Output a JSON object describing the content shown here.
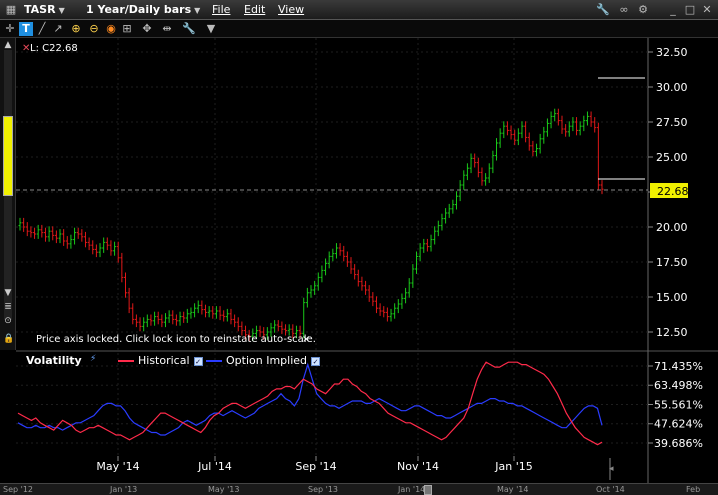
{
  "window": {
    "symbol": "TASR",
    "period": "1 Year/Daily bars",
    "menu": [
      "File",
      "Edit",
      "View"
    ]
  },
  "chart": {
    "last_label": "L: C22.68",
    "last_price": "22.68",
    "lock_message": "Price axis locked. Click lock icon to reinstate auto-scale.",
    "lock_close": "×",
    "price_ticks": [
      "32.50",
      "30.00",
      "27.50",
      "25.00",
      "22.50",
      "20.00",
      "17.50",
      "15.00",
      "12.50"
    ],
    "vol_ticks": [
      "71.435%",
      "63.498%",
      "55.561%",
      "47.624%",
      "39.686%"
    ],
    "x_ticks": [
      "May '14",
      "Jul '14",
      "Sep '14",
      "Nov '14",
      "Jan '15"
    ],
    "colors": {
      "up": "#19c819",
      "down": "#e01818",
      "historical": "#ff2a4a",
      "implied": "#2a3cff",
      "last_badge": "#f0f000"
    }
  },
  "legend": {
    "title": "Volatility",
    "historical": "Historical",
    "implied": "Option Implied"
  },
  "timeline": {
    "labels": [
      "Sep '12",
      "Jan '13",
      "May '13",
      "Sep '13",
      "Jan '14",
      "May '14",
      "Oct '14",
      "Feb"
    ]
  },
  "chart_data": {
    "type": "candlestick",
    "ohlc_close": [
      20.3,
      20.0,
      19.7,
      19.6,
      19.5,
      19.8,
      19.6,
      19.3,
      19.7,
      19.4,
      19.2,
      19.5,
      19.0,
      18.8,
      19.1,
      19.6,
      19.5,
      19.3,
      18.9,
      18.7,
      18.4,
      18.2,
      18.5,
      18.9,
      18.7,
      18.3,
      18.6,
      17.8,
      16.4,
      15.3,
      14.2,
      13.4,
      13.2,
      12.9,
      13.2,
      13.4,
      13.3,
      13.6,
      13.4,
      13.2,
      13.5,
      13.7,
      13.4,
      13.3,
      13.6,
      13.5,
      13.8,
      13.9,
      14.2,
      14.4,
      14.1,
      13.9,
      14.0,
      13.8,
      14.0,
      13.7,
      13.6,
      13.8,
      13.4,
      13.2,
      12.9,
      12.6,
      12.3,
      12.2,
      12.4,
      12.6,
      12.5,
      12.3,
      12.5,
      12.8,
      13.0,
      12.9,
      12.7,
      12.6,
      12.7,
      12.4,
      12.6,
      12.4,
      14.6,
      15.3,
      15.5,
      15.8,
      16.4,
      16.9,
      17.4,
      17.9,
      18.1,
      18.5,
      18.3,
      17.9,
      17.5,
      17.0,
      16.6,
      16.1,
      15.8,
      15.5,
      15.0,
      14.7,
      14.2,
      14.0,
      13.9,
      13.6,
      13.8,
      14.2,
      14.5,
      14.9,
      15.3,
      16.0,
      17.0,
      17.9,
      18.5,
      18.8,
      18.6,
      19.1,
      19.7,
      20.1,
      20.6,
      21.0,
      21.3,
      21.6,
      22.2,
      23.0,
      23.7,
      24.2,
      24.9,
      24.6,
      23.9,
      23.3,
      23.5,
      24.2,
      25.1,
      26.0,
      26.7,
      27.2,
      26.9,
      26.6,
      26.2,
      26.7,
      27.2,
      26.4,
      25.8,
      25.4,
      25.6,
      26.3,
      26.8,
      27.4,
      27.9,
      28.1,
      27.6,
      27.0,
      26.8,
      27.2,
      27.5,
      26.9,
      27.2,
      27.6,
      27.9,
      27.5,
      27.1,
      23.0,
      22.7
    ],
    "historical_vol": [
      52,
      51,
      50,
      49,
      50,
      48,
      47,
      46,
      45,
      47,
      49,
      48,
      47,
      45,
      44,
      45,
      46,
      46,
      47,
      46,
      45,
      44,
      43,
      43,
      42,
      41,
      42,
      43,
      44,
      46,
      48,
      50,
      52,
      52,
      51,
      50,
      49,
      48,
      47,
      46,
      45,
      44,
      46,
      49,
      51,
      52,
      54,
      55,
      56,
      56,
      55,
      54,
      55,
      56,
      57,
      58,
      59,
      61,
      62,
      62,
      63,
      63,
      62,
      64,
      66,
      65,
      64,
      62,
      61,
      60,
      62,
      64,
      64,
      66,
      66,
      64,
      63,
      61,
      60,
      58,
      57,
      56,
      54,
      52,
      51,
      50,
      49,
      48,
      48,
      47,
      46,
      45,
      44,
      43,
      42,
      41,
      42,
      44,
      46,
      48,
      50,
      54,
      60,
      66,
      70,
      73,
      72,
      71,
      71,
      72,
      73,
      73,
      73,
      72,
      72,
      71,
      70,
      69,
      68,
      66,
      63,
      60,
      56,
      52,
      49,
      46,
      44,
      42,
      41,
      40,
      39,
      40
    ],
    "implied_vol": [
      48,
      47,
      46,
      46,
      47,
      46,
      46,
      47,
      46,
      46,
      45,
      46,
      47,
      48,
      48,
      49,
      50,
      51,
      53,
      55,
      56,
      56,
      55,
      55,
      53,
      50,
      48,
      47,
      46,
      45,
      44,
      44,
      43,
      43,
      44,
      45,
      46,
      48,
      49,
      48,
      47,
      48,
      49,
      51,
      52,
      52,
      51,
      52,
      53,
      52,
      51,
      50,
      51,
      52,
      54,
      55,
      56,
      57,
      58,
      60,
      58,
      57,
      55,
      58,
      66,
      72,
      66,
      60,
      58,
      56,
      55,
      55,
      54,
      55,
      56,
      57,
      57,
      57,
      56,
      56,
      57,
      58,
      57,
      56,
      55,
      54,
      53,
      53,
      54,
      55,
      55,
      54,
      53,
      52,
      51,
      51,
      50,
      50,
      51,
      52,
      53,
      54,
      55,
      56,
      56,
      57,
      58,
      58,
      57,
      57,
      56,
      56,
      55,
      55,
      54,
      53,
      52,
      51,
      50,
      49,
      48,
      47,
      46,
      46,
      48,
      50,
      52,
      54,
      55,
      55,
      54,
      47
    ]
  }
}
